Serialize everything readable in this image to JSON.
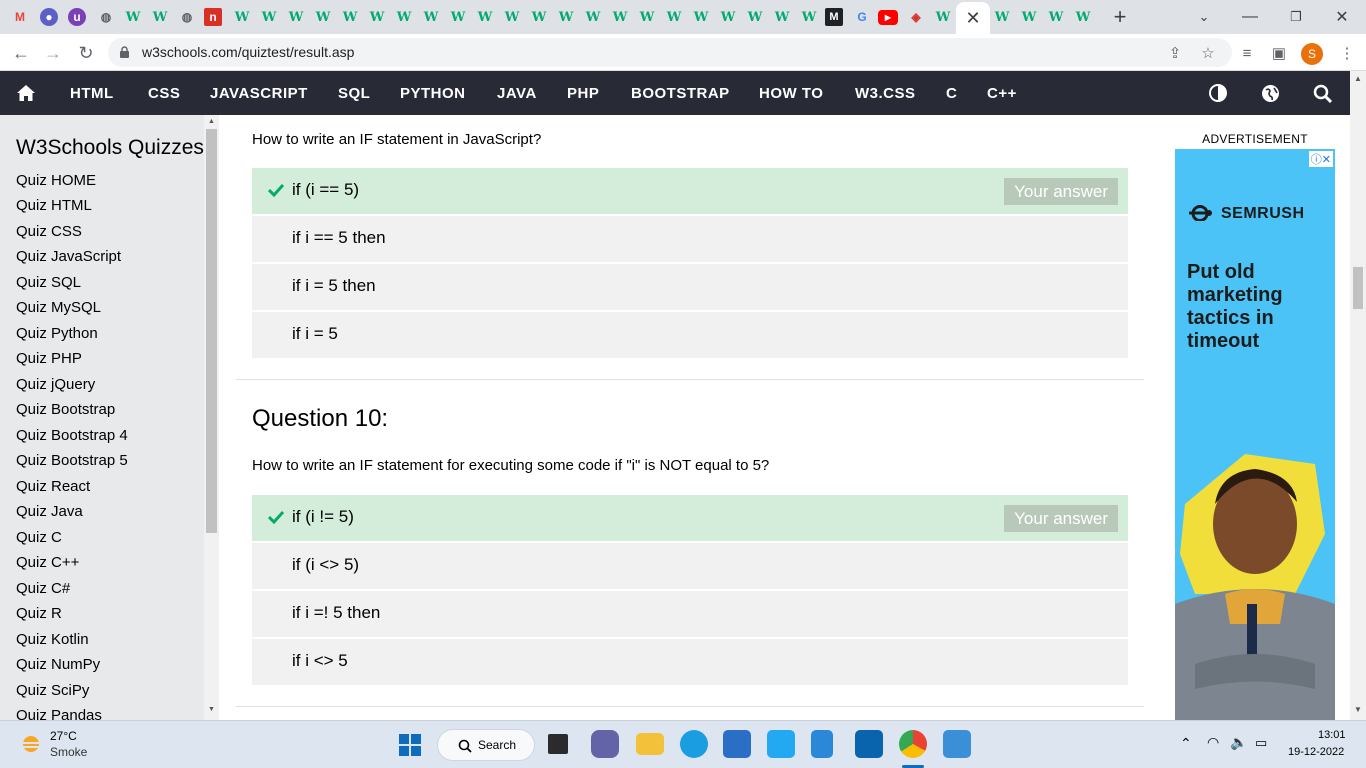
{
  "browser": {
    "url": "w3schools.com/quiztest/result.asp",
    "profile_initial": "S",
    "tab_w3_glyph": "W"
  },
  "topnav": {
    "items": [
      "HTML",
      "CSS",
      "JAVASCRIPT",
      "SQL",
      "PYTHON",
      "JAVA",
      "PHP",
      "BOOTSTRAP",
      "HOW TO",
      "W3.CSS",
      "C",
      "C++"
    ]
  },
  "sidebar": {
    "title": "W3Schools Quizzes",
    "links": [
      "Quiz HOME",
      "Quiz HTML",
      "Quiz CSS",
      "Quiz JavaScript",
      "Quiz SQL",
      "Quiz MySQL",
      "Quiz Python",
      "Quiz PHP",
      "Quiz jQuery",
      "Quiz Bootstrap",
      "Quiz Bootstrap 4",
      "Quiz Bootstrap 5",
      "Quiz React",
      "Quiz Java",
      "Quiz C",
      "Quiz C++",
      "Quiz C#",
      "Quiz R",
      "Quiz Kotlin",
      "Quiz NumPy",
      "Quiz SciPy",
      "Quiz Pandas"
    ]
  },
  "question9": {
    "text": "How to write an IF statement in JavaScript?",
    "options": [
      "if (i == 5)",
      "if i == 5 then",
      "if i = 5 then",
      "if i = 5"
    ],
    "badge": "Your answer"
  },
  "question10": {
    "heading": "Question 10:",
    "text": "How to write an IF statement for executing some code if \"i\" is NOT equal to 5?",
    "options": [
      "if (i != 5)",
      "if (i <> 5)",
      "if i =! 5 then",
      "if i <> 5"
    ],
    "badge": "Your answer"
  },
  "ad": {
    "label": "ADVERTISEMENT",
    "brand": "SEMRUSH",
    "headline": "Put old marketing tactics in timeout",
    "info_glyph": "ⓘ✕"
  },
  "taskbar": {
    "temperature": "27°C",
    "weather": "Smoke",
    "search_label": "Search",
    "time": "13:01",
    "date": "19-12-2022"
  },
  "colors": {
    "nav_bg": "#282a35",
    "correct_bg": "#d4edda",
    "option_bg": "#f1f1f1",
    "check_green": "#04aa6d",
    "ad_bg": "#4cc3f6"
  }
}
